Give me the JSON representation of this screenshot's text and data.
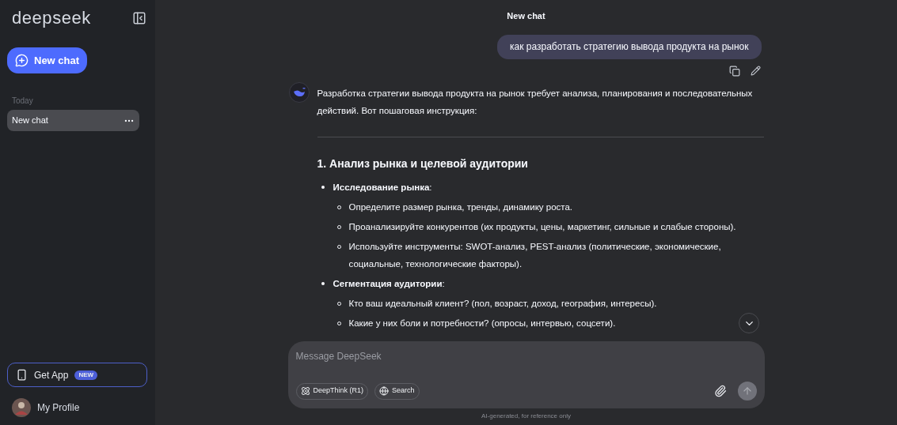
{
  "sidebar": {
    "logo": "deepseek",
    "new_chat_button": "New chat",
    "groups": [
      {
        "label": "Today",
        "items": [
          {
            "title": "New chat",
            "selected": true
          }
        ]
      }
    ],
    "get_app": {
      "label": "Get App",
      "badge": "NEW"
    },
    "profile": {
      "name": "My Profile"
    }
  },
  "header": {
    "title": "New chat"
  },
  "user_message": {
    "text": "как разработать стратегию вывода продукта на рынок"
  },
  "assistant_message": {
    "intro": "Разработка стратегии вывода продукта на рынок требует анализа, планирования и последовательных действий. Вот пошаговая инструкция:",
    "sections": [
      {
        "heading": "1. Анализ рынка и целевой аудитории",
        "items": [
          {
            "text": "**Исследование рынка**:",
            "children": [
              {
                "text": "Определите размер рынка, тренды, динамику роста."
              },
              {
                "text": "Проанализируйте конкурентов (их продукты, цены, маркетинг, сильные и слабые стороны)."
              },
              {
                "text": "Используйте инструменты: SWOT-анализ, PEST-анализ (политические, экономические, социальные, технологические факторы)."
              }
            ]
          },
          {
            "text": "**Сегментация аудитории**:",
            "children": [
              {
                "text": "Кто ваш идеальный клиент? (пол, возраст, доход, география, интересы)."
              },
              {
                "text": "Какие у них боли и потребности? (опросы, интервью, соцсети)."
              }
            ]
          }
        ]
      }
    ]
  },
  "composer": {
    "placeholder": "Message DeepSeek",
    "toggles": [
      {
        "kind": "deepthink",
        "label": "DeepThink (R1)",
        "selected": false
      },
      {
        "kind": "search",
        "label": "Search",
        "selected": false
      }
    ]
  },
  "footnote": "AI-generated, for reference only"
}
